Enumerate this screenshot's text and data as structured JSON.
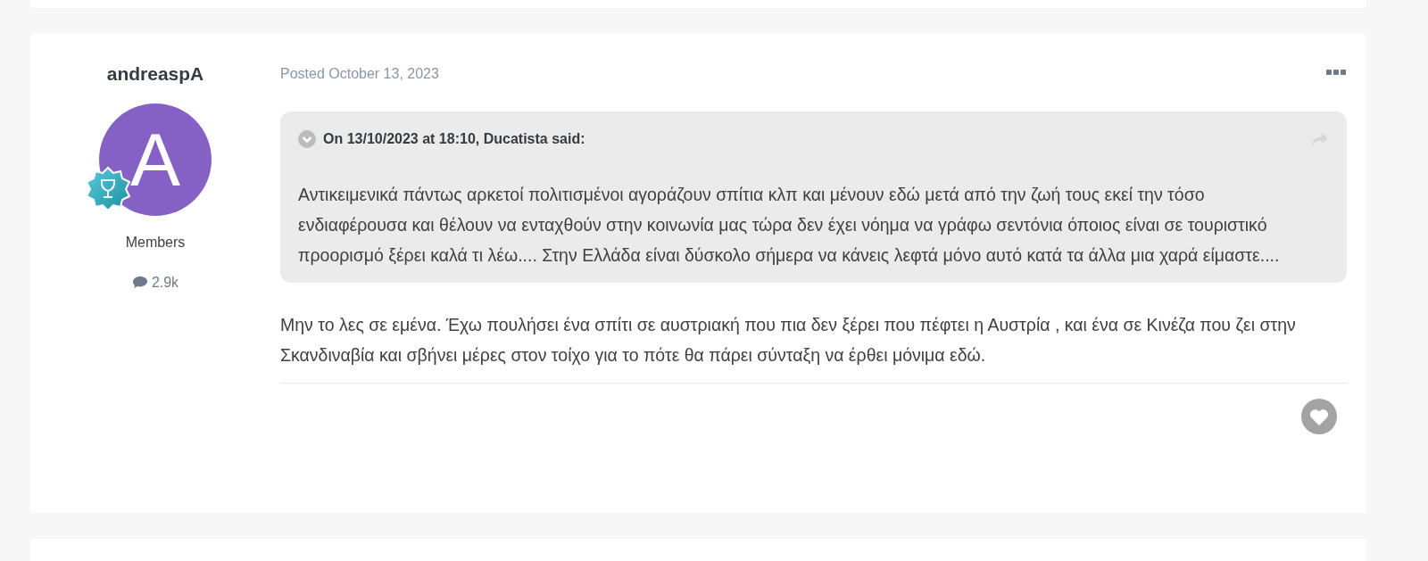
{
  "author": {
    "name": "andreaspA",
    "avatar_letter": "A",
    "group": "Members",
    "post_count": "2.9k"
  },
  "post": {
    "posted_label": "Posted",
    "date": "October 13, 2023",
    "quote": {
      "citation": "On 13/10/2023 at 18:10, Ducatista said:",
      "text": "Αντικειμενικά πάντως αρκετοί πολιτισμένοι αγοράζουν σπίτια κλπ και μένουν εδώ μετά από την ζωή τους εκεί την τόσο ενδιαφέρουσα και θέλουν να ενταχθούν στην κοινωνία μας τώρα δεν έχει νόημα να γράφω σεντόνια όποιος είναι σε τουριστικό προορισμό ξέρει καλά τι λέω.... Στην Ελλάδα είναι δύσκολο σήμερα να κάνεις λεφτά μόνο αυτό κατά τα άλλα μια χαρά είμαστε...."
    },
    "text": "Μην το λες σε εμένα. Έχω πουλήσει ένα σπίτι σε αυστριακή που πια δεν ξέρει που πέφτει η Αυστρία , και ένα σε Κινέζα που ζει στην Σκανδιναβία και σβήνει μέρες στον τοίχο για το πότε θα πάρει σύνταξη να έρθει μόνιμα εδώ."
  }
}
